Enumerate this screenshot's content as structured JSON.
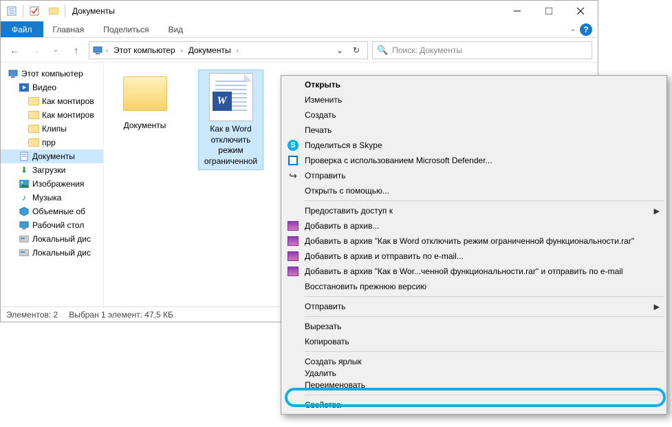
{
  "window": {
    "title": "Документы",
    "tabs": {
      "file": "Файл",
      "home": "Главная",
      "share": "Поделиться",
      "view": "Вид"
    }
  },
  "nav": {
    "breadcrumb": [
      "Этот компьютер",
      "Документы"
    ],
    "search_placeholder": "Поиск: Документы"
  },
  "tree": {
    "this_pc": "Этот компьютер",
    "videos": "Видео",
    "sub1": "Как монтиров",
    "sub2": "Как монтиров",
    "sub3": "Клипы",
    "sub4": "прр",
    "documents": "Документы",
    "downloads": "Загрузки",
    "pictures": "Изображения",
    "music": "Музыка",
    "volume3d": "Объемные об",
    "desktop": "Рабочий стол",
    "localdisk1": "Локальный дис",
    "localdisk2": "Локальный дис"
  },
  "files": {
    "folder1": "Документы",
    "doc1": "Как в Word отключить режим ограниченной"
  },
  "status": {
    "count": "Элементов: 2",
    "selection": "Выбран 1 элемент: 47,5 КБ"
  },
  "context_menu": {
    "open": "Открыть",
    "edit": "Изменить",
    "create": "Создать",
    "print": "Печать",
    "skype": "Поделиться в Skype",
    "defender": "Проверка с использованием Microsoft Defender...",
    "send": "Отправить",
    "openwith": "Открыть с помощью...",
    "grant_access": "Предоставить доступ к",
    "rar_add": "Добавить в архив...",
    "rar_add_named": "Добавить в архив \"Как в Word отключить режим ограниченной функциональности.rar\"",
    "rar_email": "Добавить в архив и отправить по e-mail...",
    "rar_named_email": "Добавить в архив \"Как в Wor...ченной функциональности.rar\" и отправить по e-mail",
    "restore": "Восстановить прежнюю версию",
    "sendto": "Отправить",
    "cut": "Вырезать",
    "copy": "Копировать",
    "shortcut": "Создать ярлык",
    "delete": "Удалить",
    "rename": "Переименовать",
    "properties": "Свойства"
  }
}
